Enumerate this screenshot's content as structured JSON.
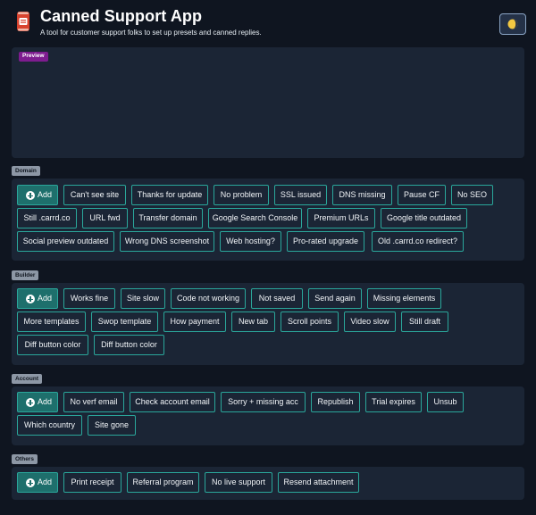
{
  "header": {
    "title": "Canned Support App",
    "subtitle": "A tool for customer support folks to set up presets and canned replies."
  },
  "preview": {
    "label": "Preview"
  },
  "add_label": "Add",
  "sections": {
    "domain": {
      "label": "Domain",
      "buttons": [
        "Can't see site",
        "Thanks for update",
        "No problem",
        "SSL issued",
        "DNS missing",
        "Pause CF",
        "No SEO",
        "Still .carrd.co",
        "URL fwd",
        "Transfer domain",
        "Google Search Console",
        "Premium URLs",
        "Google title outdated",
        "Social preview outdated",
        "Wrong DNS screenshot",
        "Web hosting?",
        "Pro-rated upgrade",
        "Old .carrd.co redirect?"
      ]
    },
    "builder": {
      "label": "Builder",
      "buttons": [
        "Works fine",
        "Site slow",
        "Code not working",
        "Not saved",
        "Send again",
        "Missing elements",
        "More templates",
        "Swop template",
        "How payment",
        "New tab",
        "Scroll points",
        "Video slow",
        "Still draft",
        "Diff button color",
        "Diff button color"
      ]
    },
    "account": {
      "label": "Account",
      "buttons": [
        "No verf email",
        "Check account email",
        "Sorry + missing acc",
        "Republish",
        "Trial expires",
        "Unsub",
        "Which country",
        "Site gone"
      ]
    },
    "others": {
      "label": "Others",
      "buttons": [
        "Print receipt",
        "Referral program",
        "No live support",
        "Resend attachment"
      ]
    }
  },
  "colors": {
    "background": "#0f1520",
    "panel": "#1b2535",
    "accent": "#2aa79b",
    "add_button": "#1e6f6c",
    "preview_tag": "#7e1c8f",
    "section_tag": "#8d97a5"
  },
  "icons": {
    "logo": "soda-can-icon",
    "theme": "half-moon-icon",
    "add": "plus-circle-icon"
  }
}
